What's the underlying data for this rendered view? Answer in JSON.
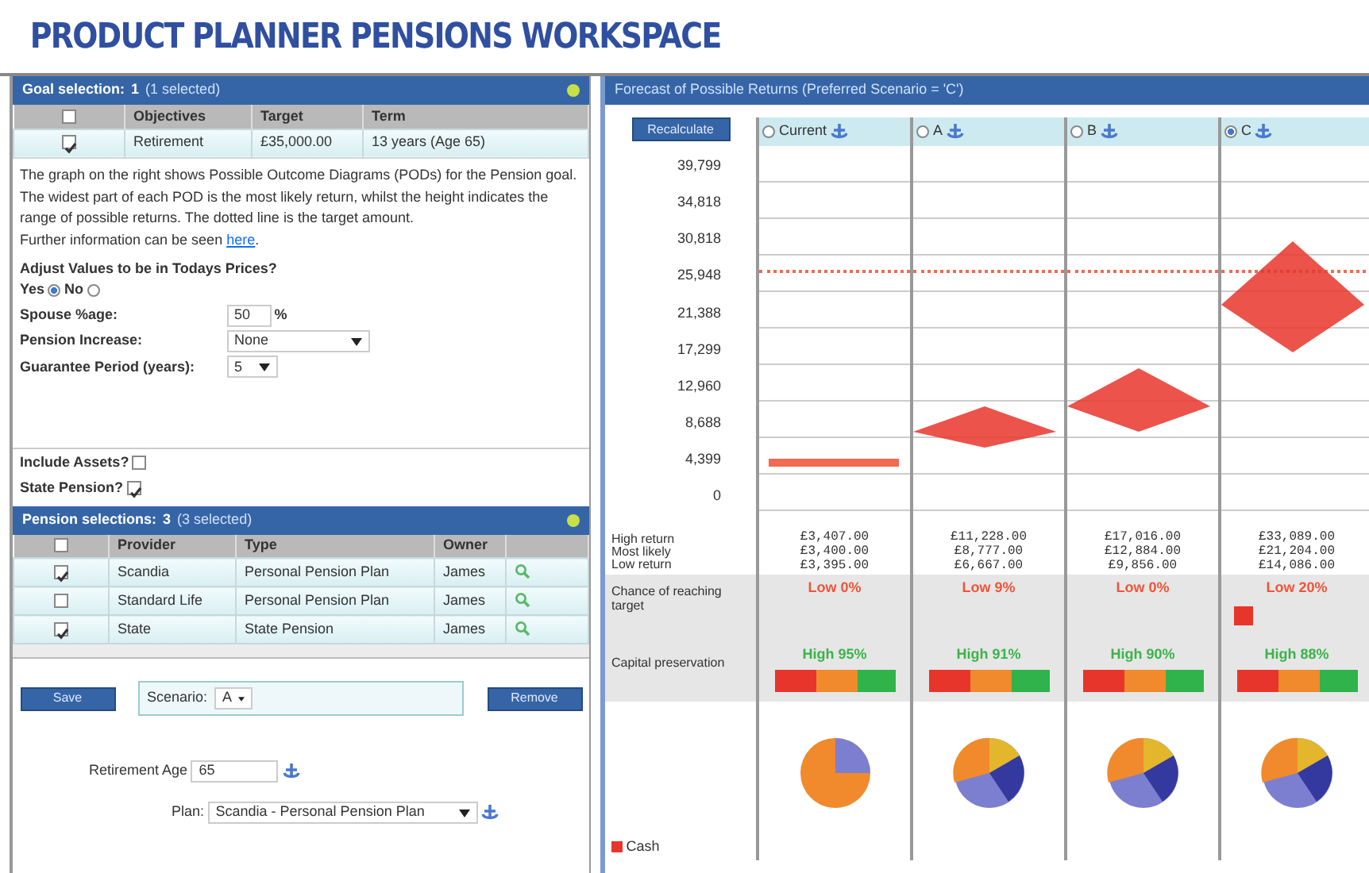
{
  "page_title": "PRODUCT PLANNER PENSIONS WORKSPACE",
  "goal_panel": {
    "title": "Goal selection:",
    "count": "1",
    "selected_note": "(1 selected)",
    "select_all_checked": false,
    "columns": [
      "Objectives",
      "Target",
      "Term"
    ],
    "rows": [
      {
        "checked": true,
        "cells": [
          "Retirement",
          "£35,000.00",
          "13 years (Age 65)"
        ]
      }
    ],
    "description": "The graph on the right shows Possible Outcome Diagrams (PODs) for the Pension goal. The widest part of each POD is the most likely return, whilst the height indicates the range of possible returns. The dotted line is the target amount.",
    "info_text": "Further information can be seen",
    "info_link": "here",
    "info_end": ".",
    "adjust_label": "Adjust Values to be in Todays Prices?",
    "radios": [
      {
        "label": "Yes",
        "selected": true
      },
      {
        "label": "No",
        "selected": false
      }
    ],
    "spouse_label": "Spouse %age:",
    "spouse_value": "50",
    "spouse_unit": "%",
    "increase_label": "Pension Increase:",
    "increase_value": "None",
    "guarantee_label": "Guarantee Period (years):",
    "guarantee_value": "5",
    "options": [
      {
        "label": "Include Assets?",
        "checked": false
      },
      {
        "label": "State Pension?",
        "checked": true
      }
    ]
  },
  "pension_panel": {
    "title": "Pension selections:",
    "count": "3",
    "selected_note": "(3 selected)",
    "select_all_checked": false,
    "columns": [
      "Provider",
      "Type",
      "Owner"
    ],
    "rows": [
      {
        "checked": true,
        "cells": [
          "Scandia",
          "Personal Pension Plan",
          "James"
        ]
      },
      {
        "checked": false,
        "cells": [
          "Standard Life",
          "Personal Pension Plan",
          "James"
        ]
      },
      {
        "checked": true,
        "cells": [
          "State",
          "State Pension",
          "James"
        ]
      }
    ],
    "save_button": "Save",
    "scenario_label": "Scenario:",
    "scenario_value": "A",
    "remove_button": "Remove",
    "retirement_label": "Retirement Age",
    "retirement_value": "65",
    "plan_label": "Plan:",
    "plan_value": "Scandia - Personal Pension Plan"
  },
  "forecast_panel": {
    "title": "Forecast of Possible Returns (Preferred Scenario = 'C')",
    "recalculate_button": "Recalculate",
    "y_labels": [
      "39,799",
      "34,818",
      "30,818",
      "25,948",
      "21,388",
      "17,299",
      "12,960",
      "8,688",
      "4,399",
      "0"
    ],
    "return_labels": [
      "High return",
      "Most likely",
      "Low return"
    ],
    "chance_label": "Chance of reaching target",
    "capital_label": "Capital preservation",
    "scenarios": [
      {
        "label": "Current",
        "selected": false,
        "returns": [
          "£3,407.00",
          "£3,400.00",
          "£3,395.00"
        ],
        "chance": "Low 0%",
        "warning": false,
        "capital": "High 95%"
      },
      {
        "label": "A",
        "selected": false,
        "returns": [
          "£11,228.00",
          "£8,777.00",
          "£6,667.00"
        ],
        "chance": "Low 9%",
        "warning": false,
        "capital": "High 91%"
      },
      {
        "label": "B",
        "selected": false,
        "returns": [
          "£17,016.00",
          "£12,884.00",
          "£9,856.00"
        ],
        "chance": "Low 0%",
        "warning": false,
        "capital": "High 90%"
      },
      {
        "label": "C",
        "selected": true,
        "returns": [
          "£33,089.00",
          "£21,204.00",
          "£14,086.00"
        ],
        "chance": "Low 20%",
        "warning": true,
        "capital": "High 88%"
      }
    ],
    "legend": [
      {
        "label": "Cash",
        "color": "#e8352b"
      }
    ]
  }
}
